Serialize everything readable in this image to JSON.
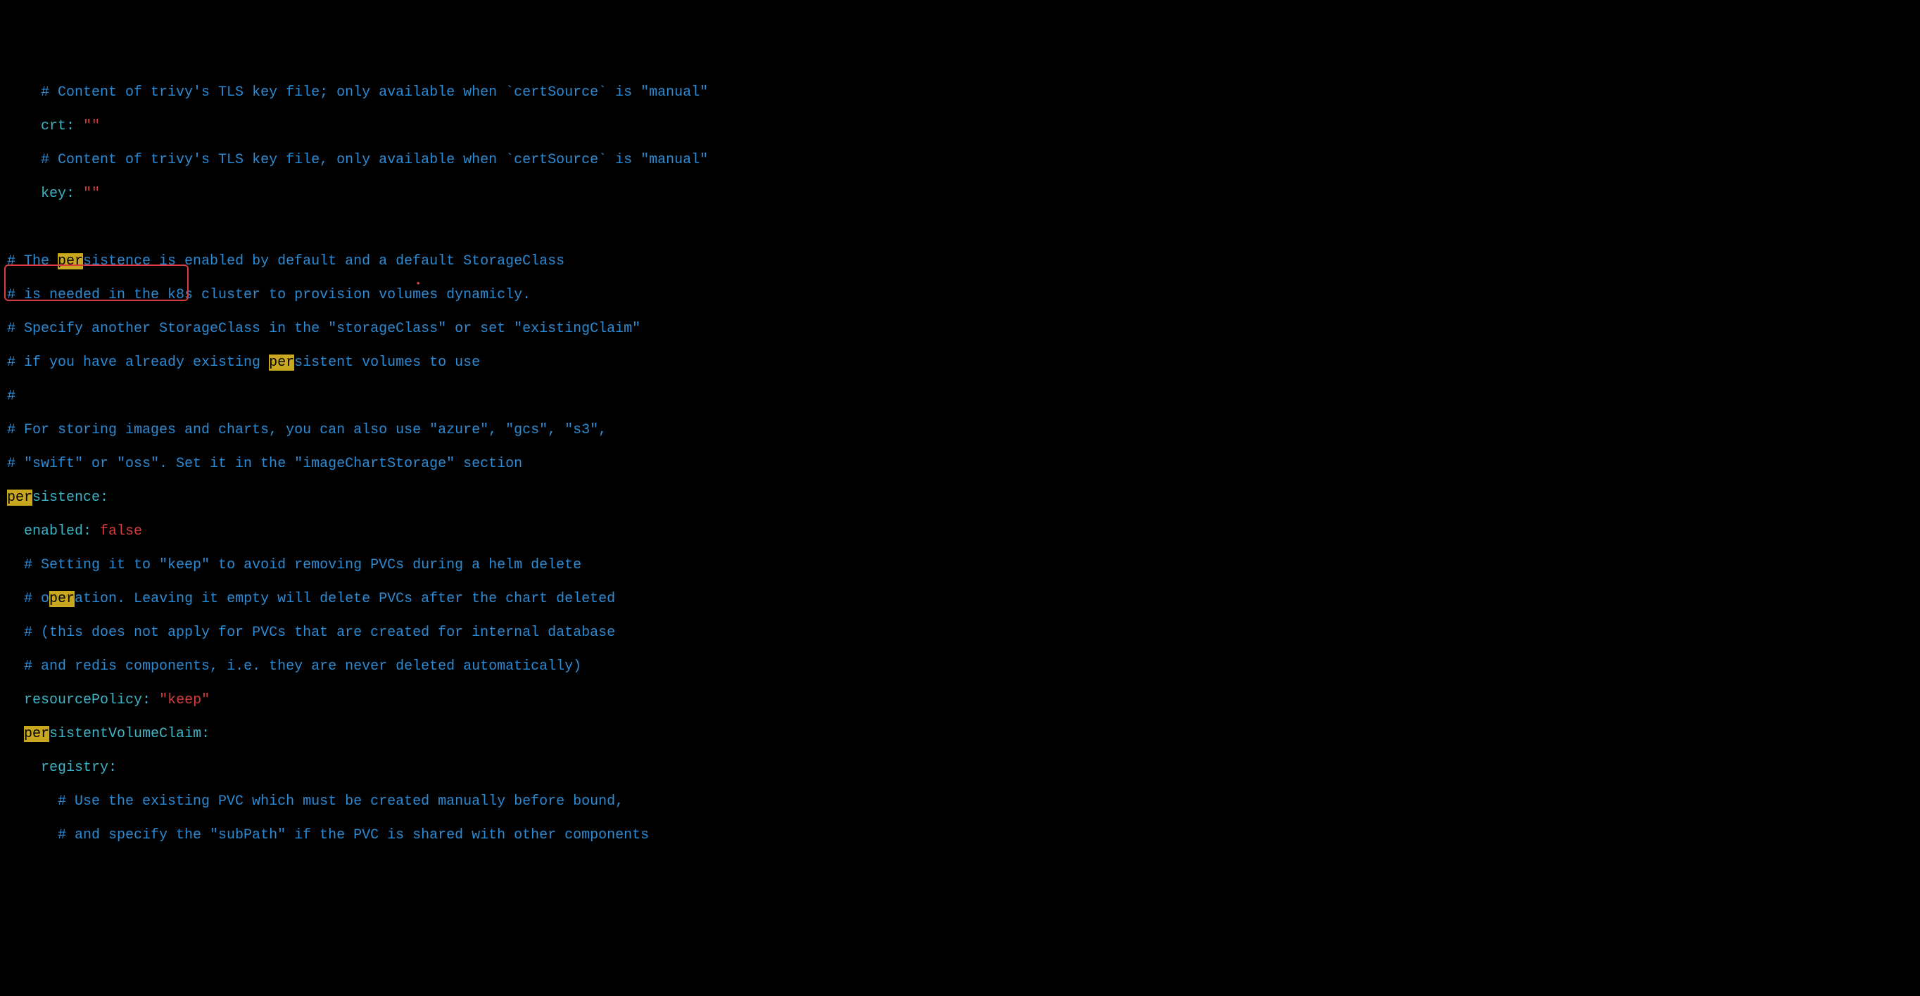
{
  "lines": {
    "l0_pre": "    ",
    "l0_comment": "# Content of trivy's TLS key file; only available when `certSource` is \"manual\"",
    "l1_pre": "    ",
    "l1_key": "crt",
    "l1_colon": ": ",
    "l1_val": "\"\"",
    "l2_pre": "    ",
    "l2_comment": "# Content of trivy's TLS key file, only available when `certSource` is \"manual\"",
    "l3_pre": "    ",
    "l3_key": "key",
    "l3_colon": ": ",
    "l3_val": "\"\"",
    "l5_a": "# The ",
    "l5_hl": "per",
    "l5_b": "sistence is enabled by default and a default StorageClass",
    "l6": "# is needed in the k8s cluster to provision volumes dynamicly.",
    "l7": "# Specify another StorageClass in the \"storageClass\" or set \"existingClaim\"",
    "l8_a": "# if you have already existing ",
    "l8_hl": "per",
    "l8_b": "sistent volumes to use",
    "l9": "#",
    "l10": "# For storing images and charts, you can also use \"azure\", \"gcs\", \"s3\",",
    "l11": "# \"swift\" or \"oss\". Set it in the \"imageChartStorage\" section",
    "l12_hl": "per",
    "l12_key": "sistence",
    "l12_colon": ":",
    "l13_pre": "  ",
    "l13_key": "enabled",
    "l13_colon": ": ",
    "l13_val": "false",
    "l14_pre": "  ",
    "l14": "# Setting it to \"keep\" to avoid removing PVCs during a helm delete",
    "l15_pre": "  ",
    "l15_a": "# o",
    "l15_hl": "per",
    "l15_b": "ation. Leaving it empty will delete PVCs after the chart deleted",
    "l16_pre": "  ",
    "l16": "# (this does not apply for PVCs that are created for internal database",
    "l17_pre": "  ",
    "l17": "# and redis components, i.e. they are never deleted automatically)",
    "l18_pre": "  ",
    "l18_key": "resourcePolicy",
    "l18_colon": ": ",
    "l18_val": "\"keep\"",
    "l19_pre": "  ",
    "l19_hl": "per",
    "l19_key": "sistentVolumeClaim",
    "l19_colon": ":",
    "l20_pre": "    ",
    "l20_key": "registry",
    "l20_colon": ":",
    "l21_pre": "      ",
    "l21": "# Use the existing PVC which must be created manually before bound,",
    "l22_pre": "      ",
    "l22": "# and specify the \"subPath\" if the PVC is shared with other components"
  },
  "highlight_text": "per"
}
